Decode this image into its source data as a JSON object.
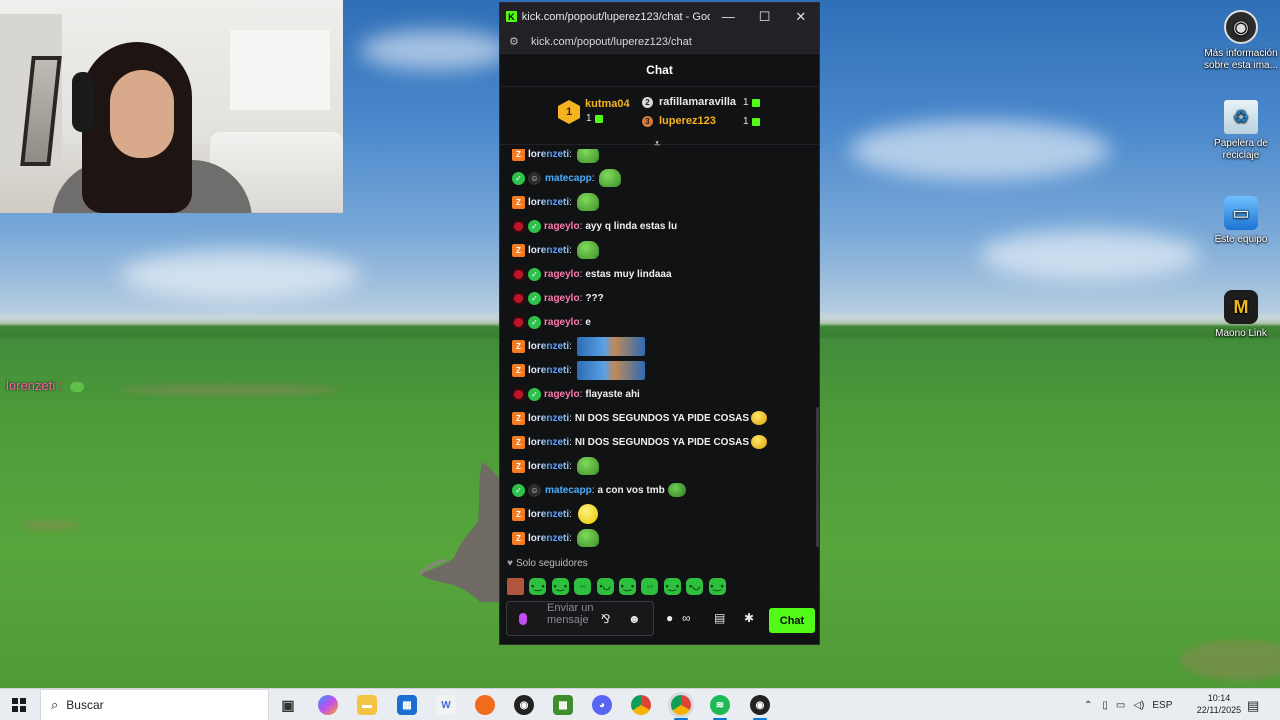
{
  "window": {
    "title": "kick.com/popout/luperez123/chat - Google...",
    "url": "kick.com/popout/luperez123/chat",
    "minimize_glyph": "—",
    "maximize_glyph": "☐",
    "close_glyph": "✕",
    "logo_letter": "K"
  },
  "chat": {
    "header": "Chat",
    "leaderboard": {
      "first_rank": "1",
      "first_name": "kutma04",
      "first_count": "1",
      "second_name": "rafillamaravilla",
      "second_count": "1",
      "third_name": "luperez123",
      "third_count": "1"
    },
    "messages": [
      {
        "user": "lorenzeti",
        "type": "loren",
        "text": "",
        "emote": "frog"
      },
      {
        "user": "matecapp",
        "type": "mate",
        "text": "",
        "emote": "frog"
      },
      {
        "user": "lorenzeti",
        "type": "loren",
        "text": "",
        "emote": "frog"
      },
      {
        "user": "rageylo",
        "type": "rage",
        "text": "ayy q linda estas lu",
        "emote": ""
      },
      {
        "user": "lorenzeti",
        "type": "loren",
        "text": "",
        "emote": "frog"
      },
      {
        "user": "rageylo",
        "type": "rage",
        "text": "estas muy lindaaa",
        "emote": ""
      },
      {
        "user": "rageylo",
        "type": "rage",
        "text": "???",
        "emote": ""
      },
      {
        "user": "rageylo",
        "type": "rage",
        "text": "e",
        "emote": ""
      },
      {
        "user": "lorenzeti",
        "type": "loren",
        "text": "",
        "emote": "wide"
      },
      {
        "user": "lorenzeti",
        "type": "loren",
        "text": "",
        "emote": "wide"
      },
      {
        "user": "rageylo",
        "type": "rage",
        "text": "flayaste ahi",
        "emote": ""
      },
      {
        "user": "lorenzeti",
        "type": "loren",
        "text": "NI DOS SEGUNDOS YA PIDE COSAS",
        "emote": "sad"
      },
      {
        "user": "lorenzeti",
        "type": "loren",
        "text": "NI DOS SEGUNDOS YA PIDE COSAS",
        "emote": "sad"
      },
      {
        "user": "lorenzeti",
        "type": "loren",
        "text": "",
        "emote": "frog"
      },
      {
        "user": "matecapp",
        "type": "mate",
        "text": "a con vos tmb",
        "emote": "small"
      },
      {
        "user": "lorenzeti",
        "type": "loren",
        "text": "",
        "emote": "yellow"
      },
      {
        "user": "lorenzeti",
        "type": "loren",
        "text": "",
        "emote": "frog"
      }
    ],
    "followers_only": "Solo seguidores",
    "input_placeholder": "Enviar un mensaje",
    "send_label": "Chat"
  },
  "overlay": {
    "user": "lorenzeti",
    "colon": ":"
  },
  "desktop_icons": [
    {
      "label": "Más información sobre esta ima...",
      "icon": "info-icon"
    },
    {
      "label": "Papelera de reciclaje",
      "icon": "recycle-bin-icon"
    },
    {
      "label": "Este equipo",
      "icon": "computer-icon"
    },
    {
      "label": "Maono Link",
      "icon": "maono-icon"
    }
  ],
  "taskbar": {
    "search_placeholder": "Buscar",
    "language": "ESP",
    "time": "10:14",
    "date": "22/11/2025"
  },
  "colors": {
    "kick_green": "#53fc18",
    "rage_pink": "#ff7ab0",
    "mate_blue": "#4aaeff",
    "popup_bg": "#111214"
  }
}
